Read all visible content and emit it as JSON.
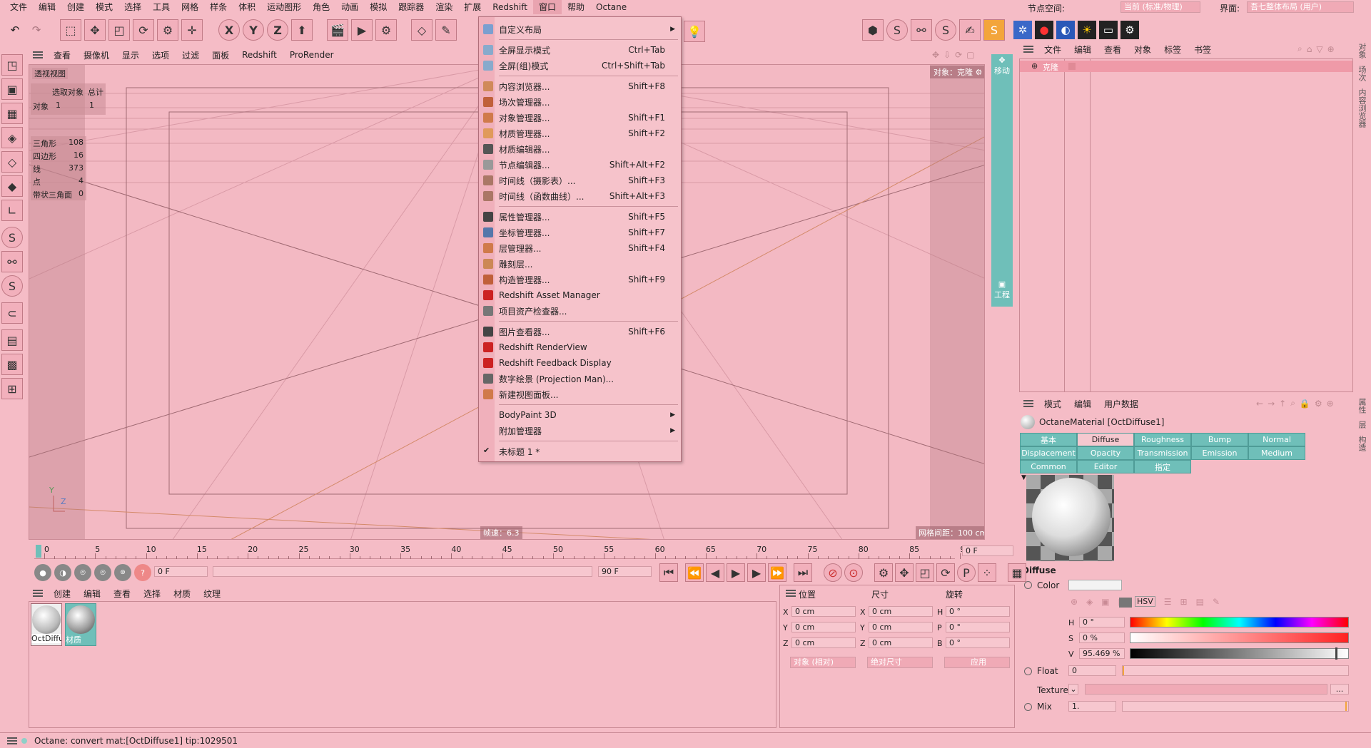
{
  "menubar": {
    "items": [
      "文件",
      "编辑",
      "创建",
      "模式",
      "选择",
      "工具",
      "网格",
      "样条",
      "体积",
      "运动图形",
      "角色",
      "动画",
      "模拟",
      "跟踪器",
      "渲染",
      "扩展",
      "Redshift",
      "窗口",
      "帮助",
      "Octane"
    ],
    "active_index": 17,
    "node_space_label": "节点空间:",
    "node_space_value": "当前 (标准/物理)",
    "layout_label": "界面:",
    "layout_value": "吾七整体布局 (用户)"
  },
  "toolbar": {
    "axis_x": "X",
    "axis_y": "Y",
    "axis_z": "Z"
  },
  "viewport": {
    "menu": [
      "查看",
      "摄像机",
      "显示",
      "选项",
      "过滤",
      "面板",
      "Redshift",
      "ProRender"
    ],
    "view_name": "透视视图",
    "stats_header": [
      "选取对象",
      "总计"
    ],
    "stats_object": [
      "对象",
      "1",
      "1"
    ],
    "stats": [
      {
        "label": "三角形",
        "value": "108"
      },
      {
        "label": "四边形",
        "value": "16"
      },
      {
        "label": "线",
        "value": "373"
      },
      {
        "label": "点",
        "value": "4"
      },
      {
        "label": "带状三角面",
        "value": "0"
      }
    ],
    "object_badge": "对象：克隆",
    "speed": "帧速：6.3",
    "grid_spacing": "网格间距：100 cm",
    "axis_y": "Y",
    "axis_z": "Z"
  },
  "right_strip": {
    "move": "移动",
    "project": "工程"
  },
  "dropdown": {
    "items": [
      {
        "label": "自定义布局",
        "shortcut": "",
        "submenu": true,
        "color": "#7b9fd0"
      },
      {
        "sep": true
      },
      {
        "label": "全屏显示模式",
        "shortcut": "Ctrl+Tab",
        "color": "#88aacc"
      },
      {
        "label": "全屏(组)模式",
        "shortcut": "Ctrl+Shift+Tab",
        "color": "#88aacc"
      },
      {
        "sep": true
      },
      {
        "label": "内容浏览器...",
        "shortcut": "Shift+F8",
        "color": "#d08a5a"
      },
      {
        "label": "场次管理器...",
        "shortcut": "",
        "color": "#c0603a"
      },
      {
        "label": "对象管理器...",
        "shortcut": "Shift+F1",
        "color": "#d07a4a"
      },
      {
        "label": "材质管理器...",
        "shortcut": "Shift+F2",
        "color": "#e09a5a"
      },
      {
        "label": "材质编辑器...",
        "shortcut": "",
        "color": "#555555"
      },
      {
        "label": "节点编辑器...",
        "shortcut": "Shift+Alt+F2",
        "color": "#999999"
      },
      {
        "label": "时间线（摄影表）...",
        "shortcut": "Shift+F3",
        "color": "#aa7766"
      },
      {
        "label": "时间线（函数曲线）...",
        "shortcut": "Shift+Alt+F3",
        "color": "#aa7766"
      },
      {
        "sep": true
      },
      {
        "label": "属性管理器...",
        "shortcut": "Shift+F5",
        "color": "#444444"
      },
      {
        "label": "坐标管理器...",
        "shortcut": "Shift+F7",
        "color": "#5577aa"
      },
      {
        "label": "层管理器...",
        "shortcut": "Shift+F4",
        "color": "#d07a4a"
      },
      {
        "label": "雕刻层...",
        "shortcut": "",
        "color": "#cc8855"
      },
      {
        "label": "构造管理器...",
        "shortcut": "Shift+F9",
        "color": "#c0603a"
      },
      {
        "label": "Redshift Asset Manager",
        "shortcut": "",
        "color": "#cc2222"
      },
      {
        "label": "项目资产检查器...",
        "shortcut": "",
        "color": "#777777"
      },
      {
        "sep": true
      },
      {
        "label": "图片查看器...",
        "shortcut": "Shift+F6",
        "color": "#444444"
      },
      {
        "label": "Redshift RenderView",
        "shortcut": "",
        "color": "#cc2222"
      },
      {
        "label": "Redshift Feedback Display",
        "shortcut": "",
        "color": "#cc2222"
      },
      {
        "label": "数字绘景 (Projection Man)...",
        "shortcut": "",
        "color": "#666666"
      },
      {
        "label": "新建视图面板...",
        "shortcut": "",
        "color": "#d07a4a"
      },
      {
        "sep": true
      },
      {
        "label": "BodyPaint 3D",
        "shortcut": "",
        "submenu": true,
        "color": ""
      },
      {
        "label": "附加管理器",
        "shortcut": "",
        "submenu": true,
        "color": ""
      },
      {
        "sep": true
      },
      {
        "label": "未标题 1 *",
        "shortcut": "",
        "check": true,
        "color": ""
      }
    ]
  },
  "object_manager": {
    "menu": [
      "文件",
      "编辑",
      "查看",
      "对象",
      "标签",
      "书签"
    ],
    "item": "克隆"
  },
  "side_tabs_top": [
    "对象",
    "场次",
    "内容浏览器"
  ],
  "side_tabs_bottom": [
    "属性",
    "层",
    "构造"
  ],
  "attr_manager": {
    "menu": [
      "模式",
      "编辑",
      "用户数据"
    ],
    "material_name": "OctaneMaterial [OctDiffuse1]",
    "tabs_row1": [
      "基本",
      "Diffuse",
      "Roughness",
      "Bump",
      "Normal"
    ],
    "tabs_row2": [
      "Displacement",
      "Opacity",
      "Transmission",
      "Emission",
      "Medium"
    ],
    "tabs_row3": [
      "Common",
      "Editor",
      "指定"
    ],
    "selected_tab": "Diffuse",
    "section": "Diffuse",
    "color_label": "Color",
    "hsv_label": "HSV",
    "h_label": "H",
    "h_value": "0 °",
    "s_label": "S",
    "s_value": "0 %",
    "v_label": "V",
    "v_value": "95.469 %",
    "v_fraction": 0.955,
    "float_label": "Float",
    "float_value": "0",
    "texture_label": "Texture",
    "texture_more": "...",
    "mix_label": "Mix",
    "mix_value": "1."
  },
  "timeline": {
    "ticks": [
      "0",
      "5",
      "10",
      "15",
      "20",
      "25",
      "30",
      "35",
      "40",
      "45",
      "50",
      "55",
      "60",
      "65",
      "70",
      "75",
      "80",
      "85",
      "90"
    ],
    "current_frame": "0 F",
    "start_field": "0 F",
    "end_field": "90 F"
  },
  "material_manager": {
    "menu": [
      "创建",
      "编辑",
      "查看",
      "选择",
      "材质",
      "纹理"
    ],
    "materials": [
      "OctDiffu",
      "材质"
    ]
  },
  "coords": {
    "headers": [
      "位置",
      "尺寸",
      "旋转"
    ],
    "rows": [
      {
        "a": "X",
        "av": "0 cm",
        "b": "X",
        "bv": "0 cm",
        "c": "H",
        "cv": "0 °"
      },
      {
        "a": "Y",
        "av": "0 cm",
        "b": "Y",
        "bv": "0 cm",
        "c": "P",
        "cv": "0 °"
      },
      {
        "a": "Z",
        "av": "0 cm",
        "b": "Z",
        "bv": "0 cm",
        "c": "B",
        "cv": "0 °"
      }
    ],
    "mode1": "对象 (相对)",
    "mode2": "绝对尺寸",
    "apply": "应用"
  },
  "status": {
    "text": "Octane:  convert mat:[OctDiffuse1]  tip:1029501"
  },
  "colors": {
    "background": "#f5bcc6",
    "teal": "#6fbfb9"
  }
}
